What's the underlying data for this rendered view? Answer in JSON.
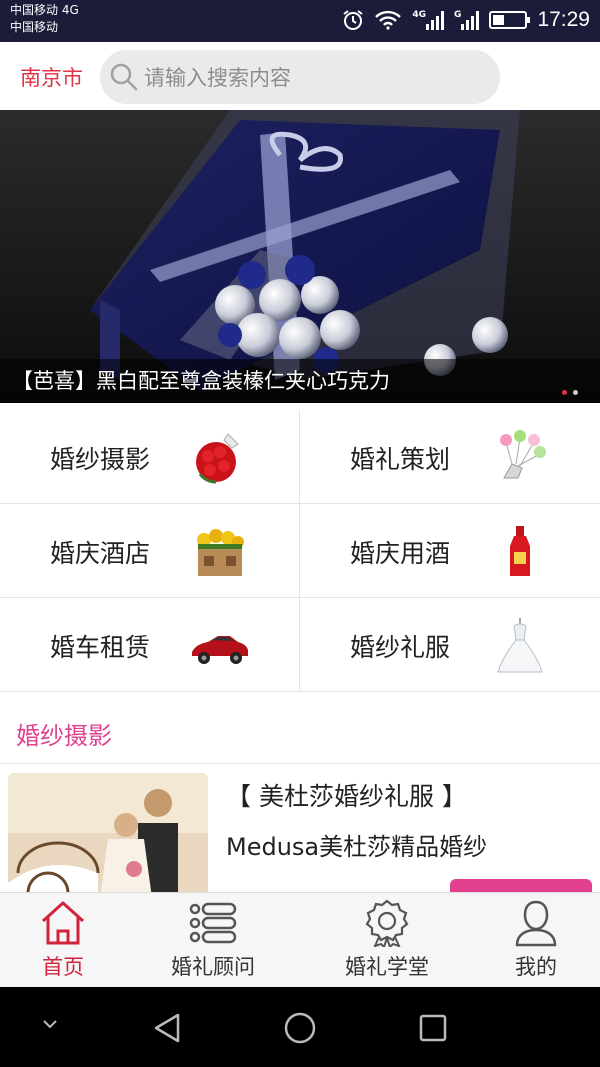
{
  "status_bar": {
    "carrier_line1": "中国移动 4G",
    "carrier_line2": "中国移动",
    "time": "17:29",
    "net1": "4G",
    "net2": "G"
  },
  "header": {
    "city": "南京市",
    "search_placeholder": "请输入搜索内容"
  },
  "banner": {
    "caption": "【芭喜】黑白配至尊盒装榛仁夹心巧克力",
    "slide_count": 2,
    "active_slide": 1
  },
  "categories": [
    {
      "label": "婚纱摄影",
      "icon": "rose-bouquet-icon"
    },
    {
      "label": "婚礼策划",
      "icon": "balloons-icon"
    },
    {
      "label": "婚庆酒店",
      "icon": "flower-house-icon"
    },
    {
      "label": "婚庆用酒",
      "icon": "wine-bottle-icon"
    },
    {
      "label": "婚车租赁",
      "icon": "sports-car-icon"
    },
    {
      "label": "婚纱礼服",
      "icon": "wedding-dress-icon"
    }
  ],
  "section": {
    "title": "婚纱摄影"
  },
  "listing": {
    "title": "【 美杜莎婚纱礼服 】",
    "subtitle": "Medusa美杜莎精品婚纱"
  },
  "bottom_nav": [
    {
      "label": "首页",
      "icon": "home-icon",
      "active": true
    },
    {
      "label": "婚礼顾问",
      "icon": "list-icon",
      "active": false
    },
    {
      "label": "婚礼学堂",
      "icon": "badge-icon",
      "active": false
    },
    {
      "label": "我的",
      "icon": "user-icon",
      "active": false
    }
  ],
  "colors": {
    "status_bg": "#1b1c39",
    "accent_red": "#e03244",
    "accent_pink": "#e2418f",
    "nav_active": "#d0233c"
  }
}
